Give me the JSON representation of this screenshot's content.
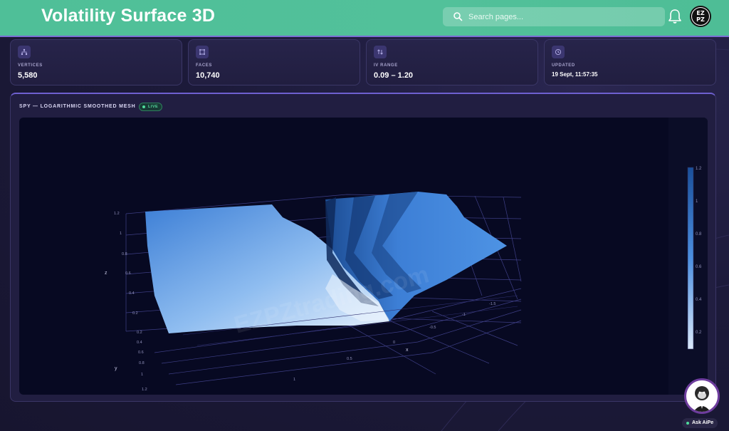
{
  "header": {
    "title": "Volatility Surface 3D",
    "search_placeholder": "Search pages...",
    "avatar_text": "EZ PZ"
  },
  "stats": [
    {
      "label": "VERTICES",
      "value": "5,580",
      "icon": "hierarchy-icon"
    },
    {
      "label": "FACES",
      "value": "10,740",
      "icon": "faces-icon"
    },
    {
      "label": "IV RANGE",
      "value": "0.09 – 1.20",
      "icon": "sort-arrows-icon"
    },
    {
      "label": "UPDATED",
      "value": "19 Sept, 11:57:35",
      "icon": "clock-icon"
    }
  ],
  "panel": {
    "title": "SPY — LOGARITHMIC SMOOTHED MESH",
    "badge": "LIVE"
  },
  "chart_data": {
    "type": "surface",
    "zlabel": "z",
    "xlabel": "x",
    "ylabel": "y",
    "z_ticks": [
      "1.2",
      "1",
      "0.8",
      "0.6",
      "0.4",
      "0.2"
    ],
    "y_ticks": [
      "0.2",
      "0.4",
      "0.6",
      "0.8",
      "1",
      "1.2"
    ],
    "x_ticks": [
      "1",
      "0.5",
      "0",
      "-0.5",
      "-1",
      "-1.5"
    ],
    "colorbar_ticks": [
      "1.2",
      "1",
      "0.8",
      "0.6",
      "0.4",
      "0.2"
    ],
    "colorbar_range": [
      0.09,
      1.2
    ],
    "colorscale": [
      "#dbe9fb",
      "#4c8fe0",
      "#1a4f9a"
    ],
    "watermark": "EZPZtrading.com"
  },
  "assistant": {
    "label": "Ask AiPe"
  }
}
